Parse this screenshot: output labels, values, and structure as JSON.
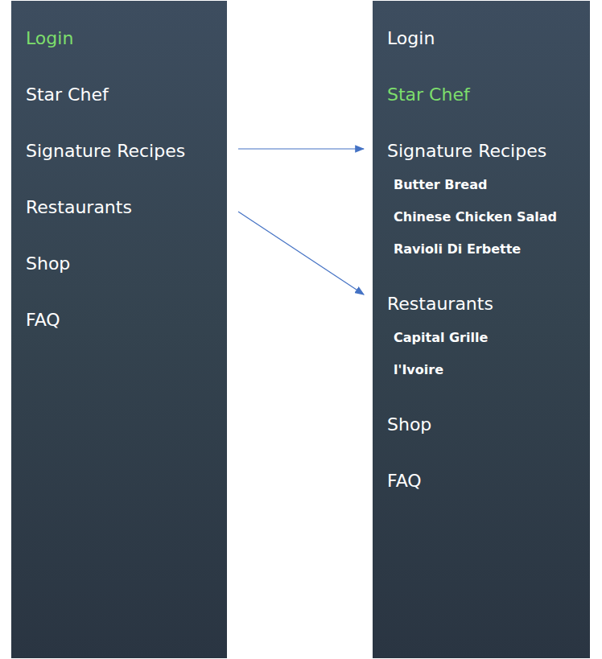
{
  "panels": [
    {
      "name": "collapsed-menu",
      "items": [
        {
          "label": "Login",
          "selected": true,
          "expanded": false,
          "children": []
        },
        {
          "label": "Star Chef",
          "selected": false,
          "expanded": false,
          "children": []
        },
        {
          "label": "Signature Recipes",
          "selected": false,
          "expanded": false,
          "children": []
        },
        {
          "label": "Restaurants",
          "selected": false,
          "expanded": false,
          "children": []
        },
        {
          "label": "Shop",
          "selected": false,
          "expanded": false,
          "children": []
        },
        {
          "label": "FAQ",
          "selected": false,
          "expanded": false,
          "children": []
        }
      ]
    },
    {
      "name": "expanded-menu",
      "items": [
        {
          "label": "Login",
          "selected": false,
          "expanded": false,
          "children": []
        },
        {
          "label": "Star Chef",
          "selected": true,
          "expanded": false,
          "children": []
        },
        {
          "label": "Signature Recipes",
          "selected": false,
          "expanded": true,
          "children": [
            {
              "label": "Butter Bread"
            },
            {
              "label": "Chinese Chicken Salad"
            },
            {
              "label": "Ravioli Di Erbette"
            }
          ]
        },
        {
          "label": "Restaurants",
          "selected": false,
          "expanded": true,
          "children": [
            {
              "label": "Capital Grille"
            },
            {
              "label": "l'Ivoire"
            }
          ]
        },
        {
          "label": "Shop",
          "selected": false,
          "expanded": false,
          "children": []
        },
        {
          "label": "FAQ",
          "selected": false,
          "expanded": false,
          "children": []
        }
      ]
    }
  ]
}
